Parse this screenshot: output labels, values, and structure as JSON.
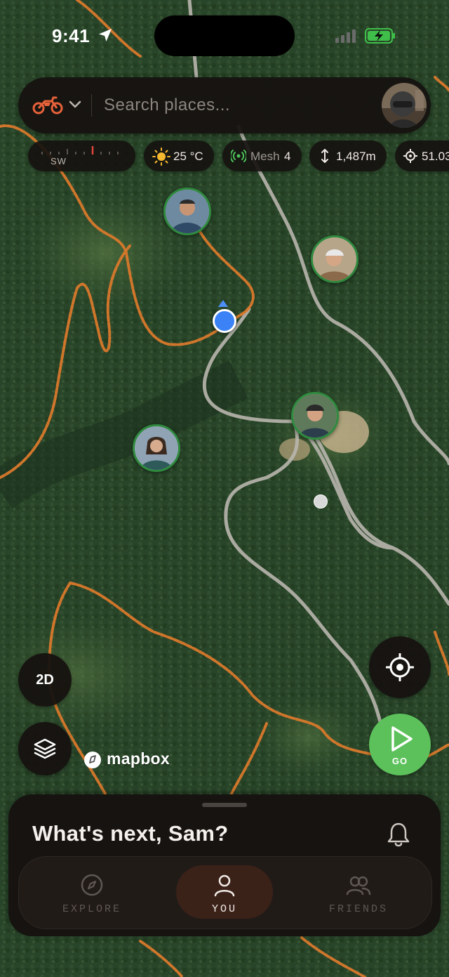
{
  "status_bar": {
    "time": "9:41"
  },
  "search": {
    "placeholder": "Search places..."
  },
  "mode": {
    "selected": "motorcycle",
    "icon": "motorcycle-icon",
    "accent": "#e8623a"
  },
  "stats": {
    "compass": {
      "heading": "SW"
    },
    "temperature": {
      "value": "25 °C"
    },
    "mesh": {
      "label": "Mesh",
      "count": "4"
    },
    "altitude": {
      "value": "1,487m"
    },
    "gps": {
      "value": "51.03"
    }
  },
  "map_controls": {
    "view_mode": "2D",
    "go_label": "GO",
    "attribution": "mapbox"
  },
  "sheet": {
    "greeting": "What's next, Sam?"
  },
  "tabs": [
    {
      "label": "EXPLORE",
      "icon": "compass-icon",
      "active": false
    },
    {
      "label": "YOU",
      "icon": "person-icon",
      "active": true
    },
    {
      "label": "FRIENDS",
      "icon": "friends-icon",
      "active": false
    }
  ],
  "colors": {
    "go_green": "#5cc15b",
    "trail_orange": "#d9792c",
    "user_blue": "#3b82f6",
    "friend_ring": "#2f8a3e",
    "panel_dark": "#161210"
  }
}
